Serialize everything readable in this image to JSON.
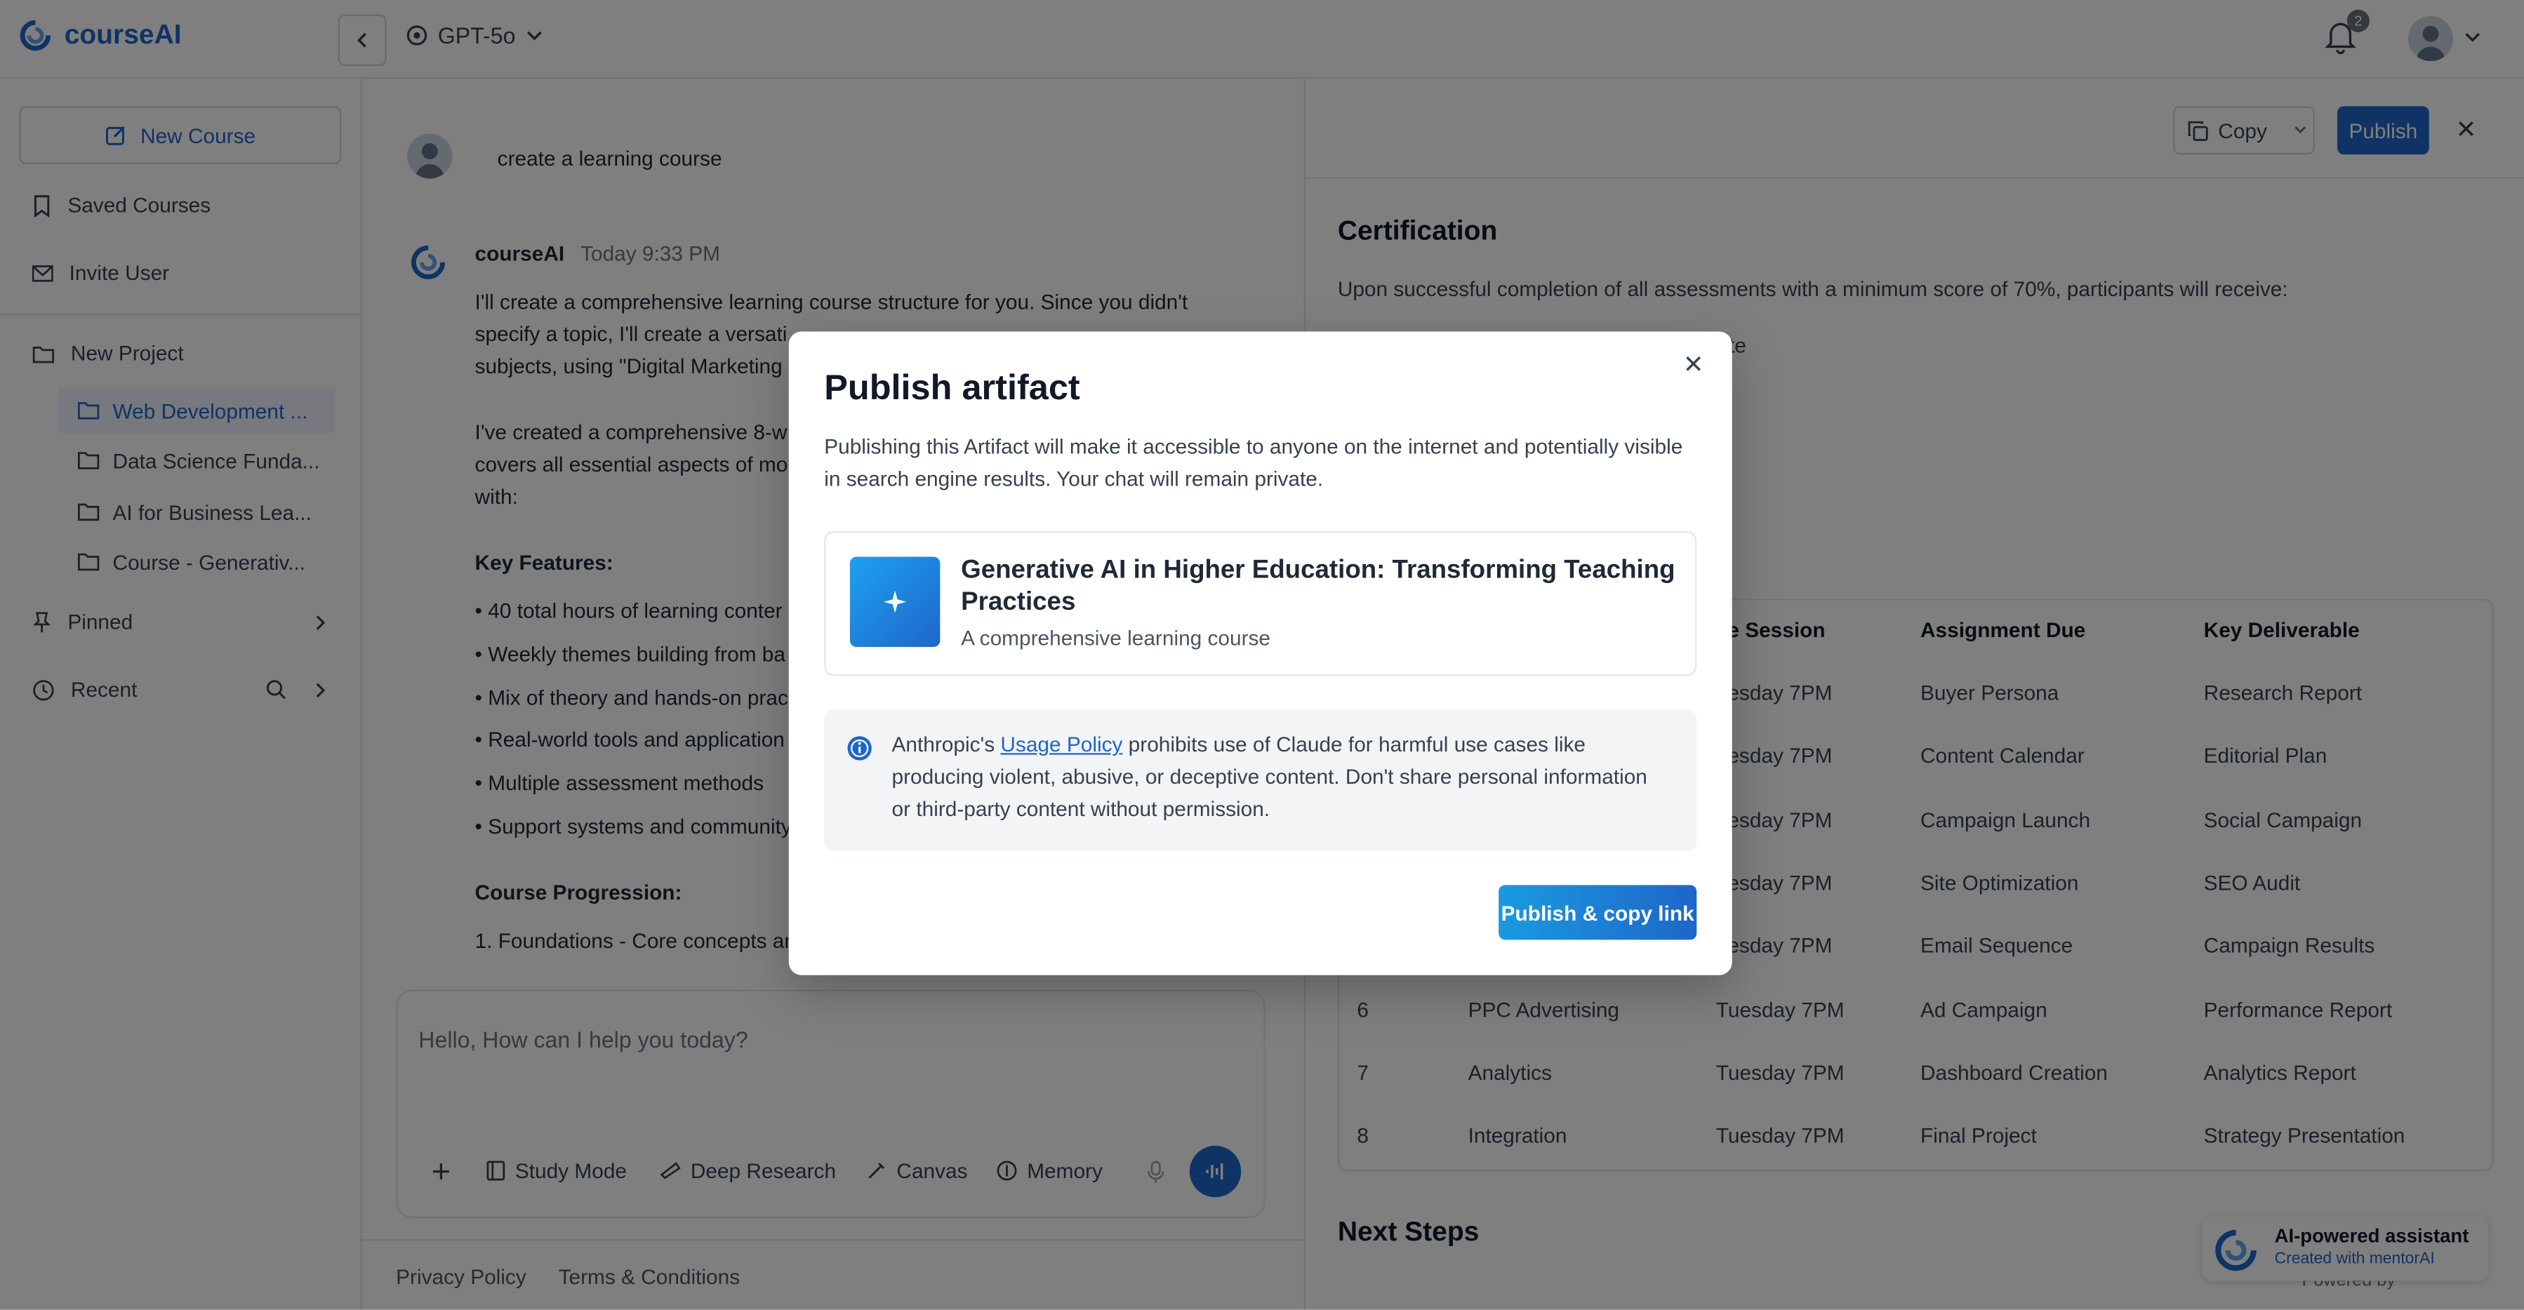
{
  "app": {
    "name": "courseAI",
    "model": "GPT-5o",
    "notification_count": "2"
  },
  "sidebar": {
    "new_course": "New Course",
    "saved_courses": "Saved Courses",
    "invite_user": "Invite User",
    "new_project": "New Project",
    "projects": [
      {
        "label": "Web Development ..."
      },
      {
        "label": "Data Science Funda..."
      },
      {
        "label": "AI for Business Lea..."
      },
      {
        "label": "Course - Generativ..."
      }
    ],
    "pinned": "Pinned",
    "recent": "Recent"
  },
  "chat": {
    "user_message": "create a learning course",
    "assistant_name": "courseAI",
    "timestamp": "Today 9:33 PM",
    "para1_lines": [
      "I'll create a comprehensive learning course structure for you. Since you didn't",
      "specify a topic, I'll create a versati",
      "subjects, using \"Digital Marketing"
    ],
    "para2_lines": [
      "I've created a comprehensive 8-w",
      "covers all essential aspects of mo",
      "with:"
    ],
    "key_features_title": "Key Features:",
    "features": [
      "• 40 total hours of learning conter",
      "• Weekly themes building from ba",
      "• Mix of theory and hands-on prac",
      "• Real-world tools and application",
      "• Multiple assessment methods",
      "• Support systems and community"
    ],
    "progression_title": "Course Progression:",
    "progression_first": "1. Foundations - Core concepts an",
    "composer_placeholder": "Hello, How can I help you today?",
    "tools": [
      "Study Mode",
      "Deep Research",
      "Canvas",
      "Memory"
    ]
  },
  "footer": {
    "privacy": "Privacy Policy",
    "terms": "Terms & Conditions"
  },
  "artifact": {
    "copy_label": "Copy",
    "publish_label": "Publish",
    "cert_title": "Certification",
    "cert_text": "Upon successful completion of all assessments with a minimum score of 70%, participants will receive:",
    "cert_partial": "te",
    "table_headers": [
      "ve Session",
      "Assignment Due",
      "Key Deliverable"
    ],
    "rows": [
      {
        "num": "",
        "topic": "",
        "session": "uesday 7PM",
        "assignment": "Buyer Persona",
        "deliverable": "Research Report"
      },
      {
        "num": "",
        "topic": "",
        "session": "uesday 7PM",
        "assignment": "Content Calendar",
        "deliverable": "Editorial Plan"
      },
      {
        "num": "",
        "topic": "",
        "session": "uesday 7PM",
        "assignment": "Campaign Launch",
        "deliverable": "Social Campaign"
      },
      {
        "num": "",
        "topic": "",
        "session": "uesday 7PM",
        "assignment": "Site Optimization",
        "deliverable": "SEO Audit"
      },
      {
        "num": "",
        "topic": "",
        "session": "uesday 7PM",
        "assignment": "Email Sequence",
        "deliverable": "Campaign Results"
      },
      {
        "num": "6",
        "topic": "PPC Advertising",
        "session": "Tuesday 7PM",
        "assignment": "Ad Campaign",
        "deliverable": "Performance Report"
      },
      {
        "num": "7",
        "topic": "Analytics",
        "session": "Tuesday 7PM",
        "assignment": "Dashboard Creation",
        "deliverable": "Analytics Report"
      },
      {
        "num": "8",
        "topic": "Integration",
        "session": "Tuesday 7PM",
        "assignment": "Final Project",
        "deliverable": "Strategy Presentation"
      }
    ],
    "next_steps": "Next Steps",
    "ai_badge_title": "AI-powered assistant",
    "ai_badge_sub": "Created with mentorAI",
    "powered_by": "Powered by"
  },
  "modal": {
    "title": "Publish artifact",
    "description": "Publishing this Artifact will make it accessible to anyone on the internet and potentially visible in search engine results. Your chat will remain private.",
    "card_title": "Generative AI in Higher Education: Transforming Teaching Practices",
    "card_subtitle": "A comprehensive learning course",
    "notice_prefix": "Anthropic's ",
    "notice_link": "Usage Policy",
    "notice_suffix": " prohibits use of Claude for harmful use cases like producing violent, abusive, or deceptive content. Don't share personal information or third-party content without permission.",
    "publish_button": "Publish & copy link"
  }
}
